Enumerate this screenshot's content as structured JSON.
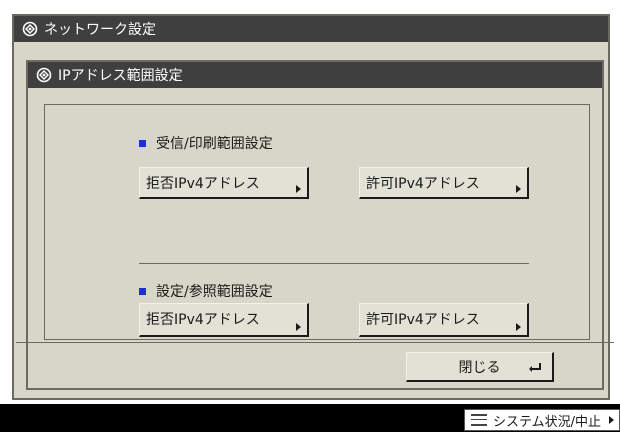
{
  "window": {
    "title": "ネットワーク設定"
  },
  "dialog": {
    "title": "IPアドレス範囲設定",
    "sections": [
      {
        "heading": "受信/印刷範囲設定",
        "deny_label": "拒否IPv4アドレス",
        "allow_label": "許可IPv4アドレス"
      },
      {
        "heading": "設定/参照範囲設定",
        "deny_label": "拒否IPv4アドレス",
        "allow_label": "許可IPv4アドレス"
      }
    ],
    "close_label": "閉じる"
  },
  "status_bar": {
    "system_status_label": "システム状況/中止"
  },
  "colors": {
    "bullet": "#1f2fd8",
    "title_bar": "#3f3f3f",
    "panel": "#d8d6c8"
  }
}
